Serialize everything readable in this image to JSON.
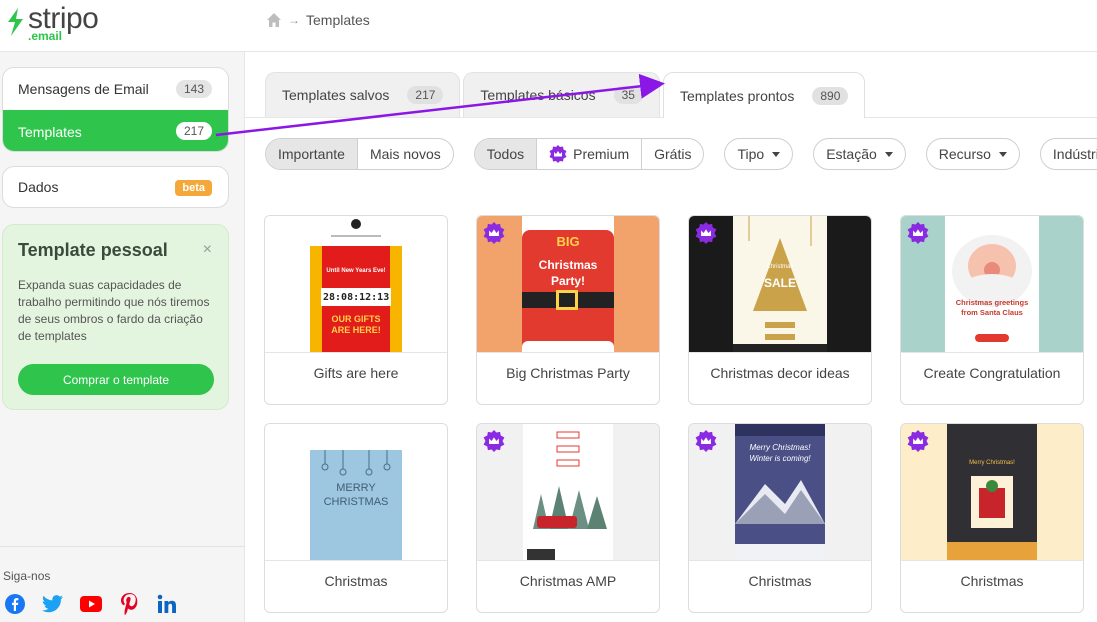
{
  "header": {
    "logo_text": "stripo",
    "logo_sub": ".email",
    "breadcrumb": "Templates",
    "icons": {
      "home": "home-icon"
    }
  },
  "sidebar": {
    "nav": [
      {
        "label": "Mensagens de Email",
        "count": "143"
      },
      {
        "label": "Templates",
        "count": "217"
      }
    ],
    "dados": {
      "label": "Dados",
      "badge": "beta"
    },
    "promo": {
      "title": "Template pessoal",
      "close": "×",
      "text": "Expanda suas capacidades de trabalho permitindo que nós tiremos de seus ombros o fardo da criação de templates",
      "button": "Comprar o template"
    },
    "follow_label": "Siga-nos",
    "socials": [
      "facebook-icon",
      "twitter-icon",
      "youtube-icon",
      "pinterest-icon",
      "linkedin-icon"
    ]
  },
  "tabs": [
    {
      "label": "Templates salvos",
      "count": "217"
    },
    {
      "label": "Templates básicos",
      "count": "35"
    },
    {
      "label": "Templates prontos",
      "count": "890"
    }
  ],
  "filters": {
    "sort": [
      "Importante",
      "Mais novos"
    ],
    "price": [
      "Todos",
      "Premium",
      "Grátis"
    ],
    "drops": [
      "Tipo",
      "Estação",
      "Recurso",
      "Indústria"
    ]
  },
  "cards": [
    {
      "title": "Gifts are here",
      "premium": false,
      "t1": "Until New Years Eve!",
      "t2": "28:08:12:13",
      "t3": "OUR GIFTS ARE HERE!"
    },
    {
      "title": "Big Christmas Party",
      "premium": true,
      "t1": "BIG",
      "t2": "Christmas",
      "t3": "Party!"
    },
    {
      "title": "Christmas decor ideas",
      "premium": true,
      "t1": "Christmas",
      "t2": "SALE"
    },
    {
      "title": "Create Congratulation",
      "premium": true,
      "t1": "Christmas greetings from Santa Claus"
    },
    {
      "title": "Christmas",
      "premium": false,
      "t1": "MERRY",
      "t2": "CHRISTMAS"
    },
    {
      "title": "Christmas AMP",
      "premium": true
    },
    {
      "title": "Christmas",
      "premium": true,
      "t1": "Merry Christmas! Winter is coming!"
    },
    {
      "title": "Christmas",
      "premium": true,
      "t1": "Merry Christmas!"
    }
  ],
  "colors": {
    "green": "#2fc54c",
    "purple": "#7b2ff2",
    "arrow": "#8a17e6"
  }
}
